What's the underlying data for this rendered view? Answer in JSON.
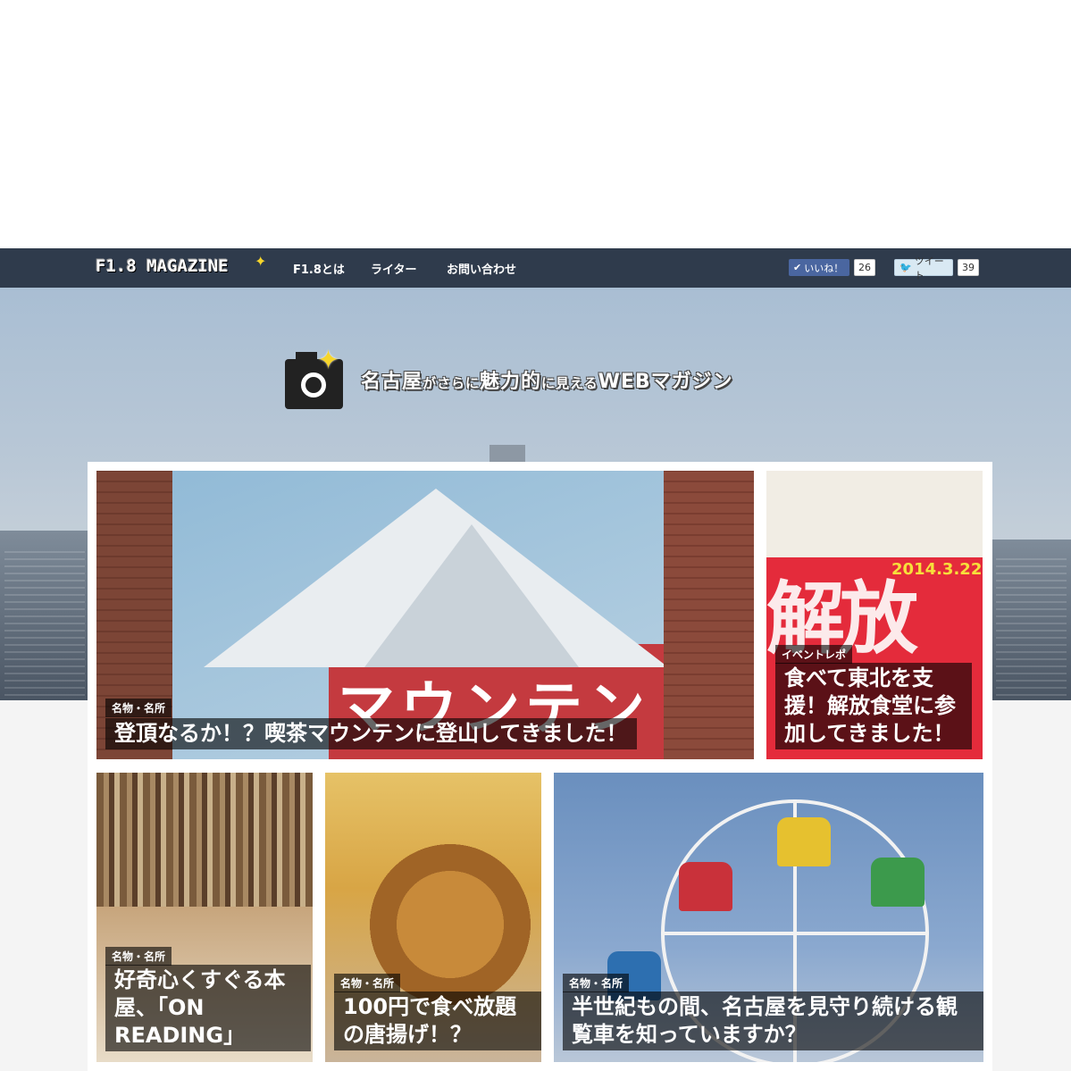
{
  "nav": {
    "logo": "F1.8 MAGAZINE",
    "links": [
      "F1.8とは",
      "ライター",
      "お問い合わせ"
    ]
  },
  "social": {
    "like_label": "いいね！",
    "like_count": "26",
    "tweet_label": "ツイート",
    "tweet_count": "39"
  },
  "hero": {
    "tagline_1": "名古屋",
    "tagline_2": "がさらに",
    "tagline_3": "魅力的",
    "tagline_4": "に見える",
    "tagline_5": "WEBマガジン"
  },
  "articles": [
    {
      "category": "名物・名所",
      "title": "登頂なるか！？喫茶マウンテンに登山してきました！"
    },
    {
      "category": "イベントレポ",
      "title": "食べて東北を支援！解放食堂に参加してきました！"
    },
    {
      "category": "名物・名所",
      "title": "好奇心くすぐる本屋、「ON READING」"
    },
    {
      "category": "名物・名所",
      "title": "100円で食べ放題の唐揚げ！？"
    },
    {
      "category": "名物・名所",
      "title": "半世紀もの間、名古屋を見守り続ける観覧車を知っていますか？"
    }
  ],
  "card1_sign": "マウンテン",
  "card2_poster": "解放",
  "card2_date": "2014.3.22"
}
